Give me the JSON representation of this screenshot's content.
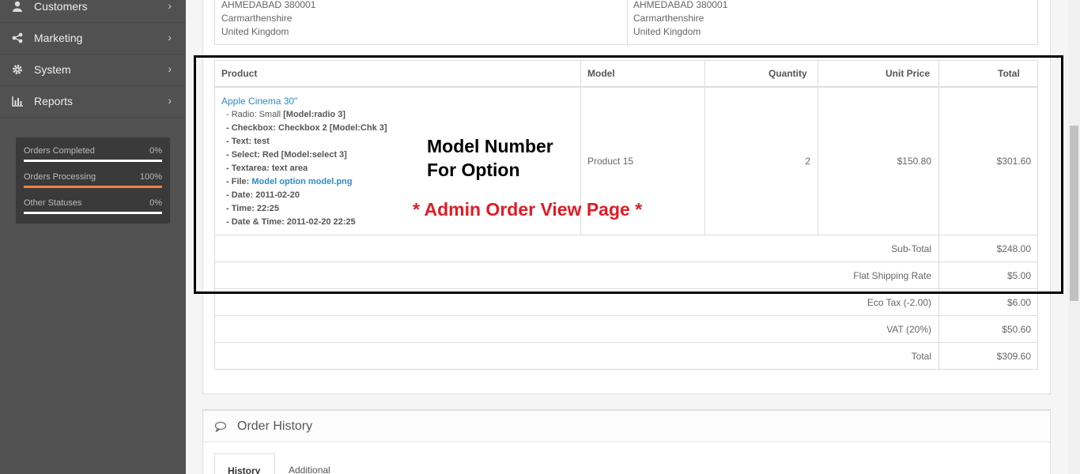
{
  "sidebar": {
    "items": [
      {
        "label": "Customers",
        "icon": "user-icon"
      },
      {
        "label": "Marketing",
        "icon": "share-icon"
      },
      {
        "label": "System",
        "icon": "gear-icon"
      },
      {
        "label": "Reports",
        "icon": "bar-chart-icon"
      }
    ],
    "stats": [
      {
        "label": "Orders Completed",
        "value": "0%",
        "fraction": 0
      },
      {
        "label": "Orders Processing",
        "value": "100%",
        "fraction": 1
      },
      {
        "label": "Other Statuses",
        "value": "0%",
        "fraction": 0
      }
    ]
  },
  "address": {
    "left": [
      "AHMEDABAD 380001",
      "Carmarthenshire",
      "United Kingdom"
    ],
    "right": [
      "AHMEDABAD 380001",
      "Carmarthenshire",
      "United Kingdom"
    ]
  },
  "products": {
    "headers": {
      "product": "Product",
      "model": "Model",
      "quantity": "Quantity",
      "unit_price": "Unit Price",
      "total": "Total"
    },
    "item": {
      "name": "Apple Cinema 30\"",
      "options": [
        {
          "prefix": "- Radio: Small ",
          "value": "[Model:radio 3]"
        },
        {
          "prefix": "- Checkbox: Checkbox 2 [Model:Chk 3]",
          "value": ""
        },
        {
          "prefix": "- Text: test",
          "value": ""
        },
        {
          "prefix": "- Select: Red [Model:select 3]",
          "value": ""
        },
        {
          "prefix": "- Textarea: text area",
          "value": ""
        },
        {
          "prefix": "- File: ",
          "link": "Model option model.png"
        },
        {
          "prefix": "- Date: 2011-02-20",
          "value": ""
        },
        {
          "prefix": "- Time: 22:25",
          "value": ""
        },
        {
          "prefix": "- Date & Time: 2011-02-20 22:25",
          "value": ""
        }
      ],
      "model": "Product 15",
      "quantity": "2",
      "unit_price": "$150.80",
      "total": "$301.60"
    },
    "totals": [
      {
        "label": "Sub-Total",
        "value": "$248.00"
      },
      {
        "label": "Flat Shipping Rate",
        "value": "$5.00"
      },
      {
        "label": "Eco Tax (-2.00)",
        "value": "$6.00"
      },
      {
        "label": "VAT (20%)",
        "value": "$50.60"
      },
      {
        "label": "Total",
        "value": "$309.60"
      }
    ]
  },
  "annotations": {
    "line1": "Model Number",
    "line2": "For Option",
    "page_note": "* Admin Order View Page *"
  },
  "history": {
    "title": "Order History",
    "tabs": [
      "History",
      "Additional"
    ]
  },
  "colors": {
    "sidebar": "#515151",
    "accent": "#f0843c",
    "link": "#2e8bcc",
    "annotation_red": "#e01b24"
  }
}
